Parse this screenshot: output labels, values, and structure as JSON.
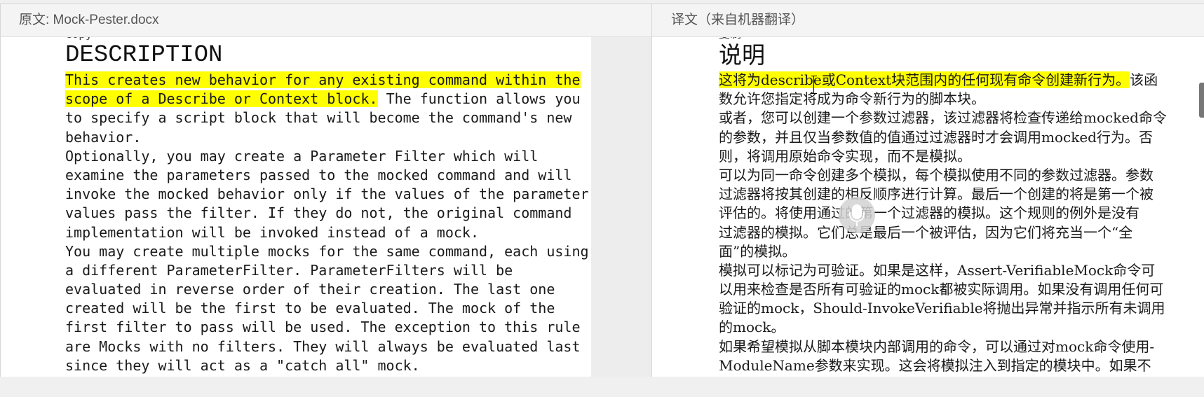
{
  "left_pane": {
    "header_label": "原文: Mock-Pester.docx",
    "cut_word": "copy",
    "heading": "DESCRIPTION",
    "lines": [
      {
        "hl": "This creates new behavior for any existing command within the",
        "rest": ""
      },
      {
        "hl": "scope of a Describe or Context block.",
        "rest": " The function allows you"
      },
      {
        "hl": "",
        "rest": "to specify a script block that will become the command's new"
      },
      {
        "hl": "",
        "rest": "behavior."
      },
      {
        "hl": "",
        "rest": "Optionally, you may create a Parameter Filter which will"
      },
      {
        "hl": "",
        "rest": "examine the parameters passed to the mocked command and will"
      },
      {
        "hl": "",
        "rest": "invoke the mocked behavior only if the values of the parameter"
      },
      {
        "hl": "",
        "rest": "values pass the filter. If they do not, the original command"
      },
      {
        "hl": "",
        "rest": "implementation will be invoked instead of a mock."
      },
      {
        "hl": "",
        "rest": "You may create multiple mocks for the same command, each using"
      },
      {
        "hl": "",
        "rest": "a different ParameterFilter. ParameterFilters will be"
      },
      {
        "hl": "",
        "rest": "evaluated in reverse order of their creation. The last one"
      },
      {
        "hl": "",
        "rest": "created will be the first to be evaluated. The mock of the"
      },
      {
        "hl": "",
        "rest": "first filter to pass will be used. The exception to this rule"
      },
      {
        "hl": "",
        "rest": "are Mocks with no filters. They will always be evaluated last"
      },
      {
        "hl": "",
        "rest": "since they will act as a \"catch all\" mock."
      }
    ]
  },
  "right_pane": {
    "header_label": "译文（来自机器翻译）",
    "cut_word": "复制",
    "heading": "说明",
    "lines": [
      {
        "hl": "这将为describe或Context块范围内的任何现有命令创建新行为。",
        "rest": "该函"
      },
      {
        "hl": "",
        "rest": "数允许您指定将成为命令新行为的脚本块。"
      },
      {
        "hl": "",
        "rest": "或者，您可以创建一个参数过滤器，该过滤器将检查传递给mocked命令"
      },
      {
        "hl": "",
        "rest": "的参数，并且仅当参数值的值通过过滤器时才会调用mocked行为。否"
      },
      {
        "hl": "",
        "rest": "则，将调用原始命令实现，而不是模拟。"
      },
      {
        "hl": "",
        "rest": "可以为同一命令创建多个模拟，每个模拟使用不同的参数过滤器。参数"
      },
      {
        "hl": "",
        "rest": "过滤器将按其创建的相反顺序进行计算。最后一个创建的将是第一个被"
      },
      {
        "hl": "",
        "rest": "评估的。将使用通过的第一个过滤器的模拟。这个规则的例外是没有"
      },
      {
        "hl": "",
        "rest": "过滤器的模拟。它们总是最后一个被评估，因为它们将充当一个“全"
      },
      {
        "hl": "",
        "rest": "面”的模拟。"
      },
      {
        "hl": "",
        "rest": "模拟可以标记为可验证。如果是这样，Assert-VerifiableMock命令可"
      },
      {
        "hl": "",
        "rest": "以用来检查是否所有可验证的mock都被实际调用。如果没有调用任何可"
      },
      {
        "hl": "",
        "rest": "验证的mock，Should-InvokeVerifiable将抛出异常并指示所有未调用"
      },
      {
        "hl": "",
        "rest": "的mock。"
      },
      {
        "hl": "",
        "rest": "如果希望模拟从脚本模块内部调用的命令，可以通过对mock命令使用-"
      },
      {
        "hl": "",
        "rest": "ModuleName参数来实现。这会将模拟注入到指定的模块中。如果不"
      }
    ]
  },
  "icons": {
    "text_cursor": "ibeam-cursor-icon",
    "voice_input": "microphone-icon"
  },
  "colors": {
    "highlight": "#ffff00",
    "pane_background": "#ededed",
    "page_background": "#ffffff"
  }
}
